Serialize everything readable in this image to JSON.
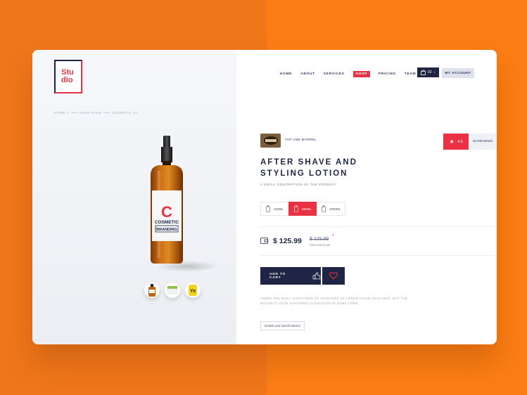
{
  "logo": {
    "line1": "Stu",
    "line2": "dio"
  },
  "breadcrumb": [
    "HOME 2",
    "SHOP PAGE",
    "COSMETIC 01"
  ],
  "product_image": {
    "label_letter": "C",
    "label_line1": "COSMETIC",
    "label_line2": "BRANDING"
  },
  "thumbnails": [
    {
      "name": "bottle-thumb"
    },
    {
      "name": "jar-thumb"
    },
    {
      "name": "yellow-jar-thumb",
      "text": "Ye"
    }
  ],
  "nav": {
    "items": [
      "HOME",
      "ABOUT",
      "SERVICES",
      "SHOP",
      "PRICING",
      "TEAM"
    ],
    "active": "SHOP"
  },
  "cart": {
    "count": "02"
  },
  "account": {
    "label": "MY ACCOUNT"
  },
  "brand": {
    "name": "TAP AND BARREL"
  },
  "rating": {
    "score": "4.5",
    "reviews": "15 REVIEWS"
  },
  "product": {
    "title": "AFTER SHAVE AND STYLING LOTION",
    "description": "A SMALL DESCRIPTION OF THE PRODUCT",
    "sizes": [
      "250ML",
      "500ML",
      "1000ML"
    ],
    "selected_size": "500ML",
    "price": "$ 125.99",
    "old_price": "$ 125.99",
    "discount_label": "Discounted rate",
    "star": "*",
    "add_to_cart": "ADD TO CART",
    "lorem": "THERE ARE MANY VARIATIONS OF PASSAGES OF LOREM IPSUM AVAILABLE, BUT THE MAJORITY HAVE SUFFERED ALTERATION IN SOME FORM",
    "details_button": "Details and specifications"
  },
  "colors": {
    "accent": "#ea3143",
    "navy": "#1e2545",
    "orange": "#f0761a"
  }
}
